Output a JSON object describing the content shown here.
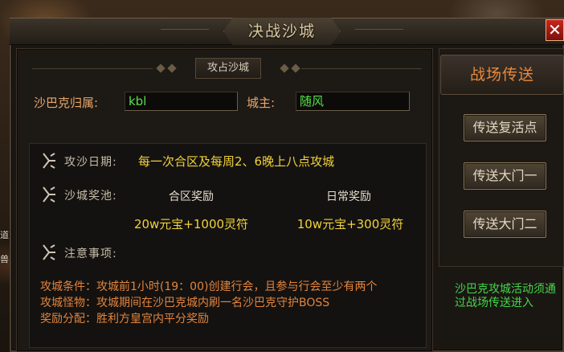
{
  "window": {
    "title": "决战沙城",
    "close_label": "✕"
  },
  "world": {
    "left_text_1": "道",
    "left_text_2": "兽"
  },
  "section": {
    "title": "攻占沙城"
  },
  "ownership": {
    "owner_label": "沙巴克归属:",
    "owner_value": "kbl",
    "lord_label": "城主:",
    "lord_value": "随风"
  },
  "info": {
    "date_label": "攻沙日期:",
    "date_value": "每一次合区及每周2、6晚上八点攻城",
    "pool_label": "沙城奖池:",
    "reward_merge_head": "合区奖励",
    "reward_daily_head": "日常奖励",
    "reward_merge_value": "20w元宝+1000灵符",
    "reward_daily_value": "10w元宝+300灵符",
    "notice_label": "注意事项:",
    "notes": [
      "攻城条件：攻城前1小时(19：00)创建行会，且参与行会至少有两个",
      "攻城怪物：攻城期间在沙巴克城内刷一名沙巴克守护BOSS",
      "奖励分配：胜利方皇宫内平分奖励"
    ]
  },
  "side": {
    "title": "战场传送",
    "buttons": [
      "传送复活点",
      "传送大门一",
      "传送大门二"
    ],
    "note": "沙巴克攻城活动须通过战场传送进入"
  },
  "colors": {
    "accent_orange": "#e8883c",
    "value_yellow": "#f0d23c",
    "value_green": "#58e04a",
    "note_green": "#45d64a"
  }
}
